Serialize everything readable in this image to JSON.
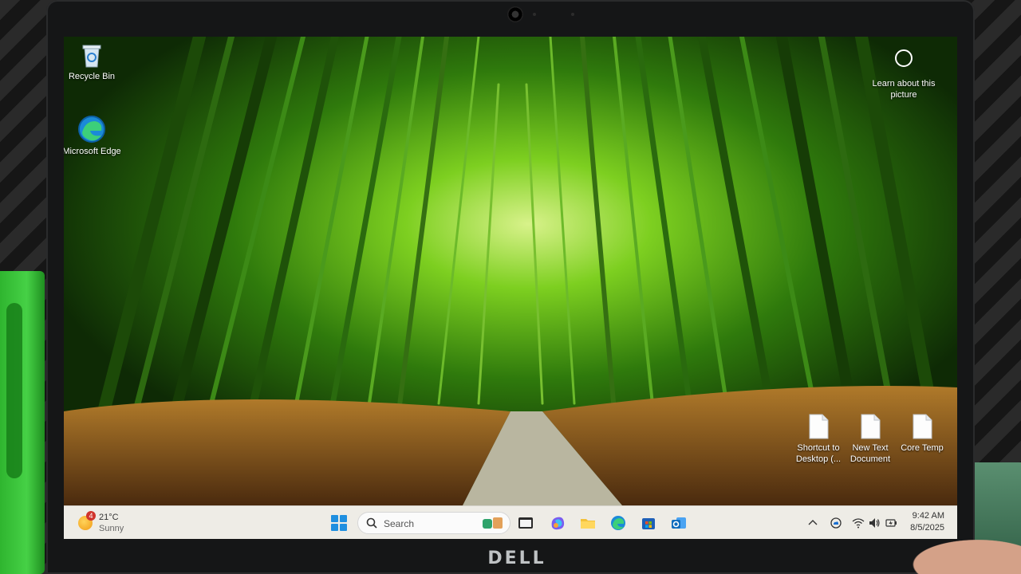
{
  "desktop": {
    "icons": [
      {
        "label": "Recycle Bin"
      },
      {
        "label": "Microsoft Edge"
      },
      {
        "label": "Shortcut to Desktop (..."
      },
      {
        "label": "New Text Document"
      },
      {
        "label": "Core Temp"
      }
    ],
    "learn_about": "Learn about this picture"
  },
  "taskbar": {
    "weather": {
      "badge": "4",
      "temperature": "21°C",
      "condition": "Sunny"
    },
    "search_placeholder": "Search",
    "pinned_icons": [
      "widgets-icon",
      "terminal-icon",
      "copilot-icon",
      "file-explorer-icon",
      "edge-icon",
      "store-icon",
      "outlook-icon"
    ],
    "tray_icons": [
      "chevron-up-icon",
      "onedrive-icon",
      "wifi-icon",
      "volume-icon",
      "battery-icon"
    ],
    "clock": {
      "time": "9:42 AM",
      "date": "8/5/2025"
    }
  },
  "device": {
    "brand": "DELL"
  },
  "colors": {
    "taskbar_bg": "#eeece6",
    "accent": "#1f8fe0",
    "wallpaper_green": "#3c7a12"
  }
}
